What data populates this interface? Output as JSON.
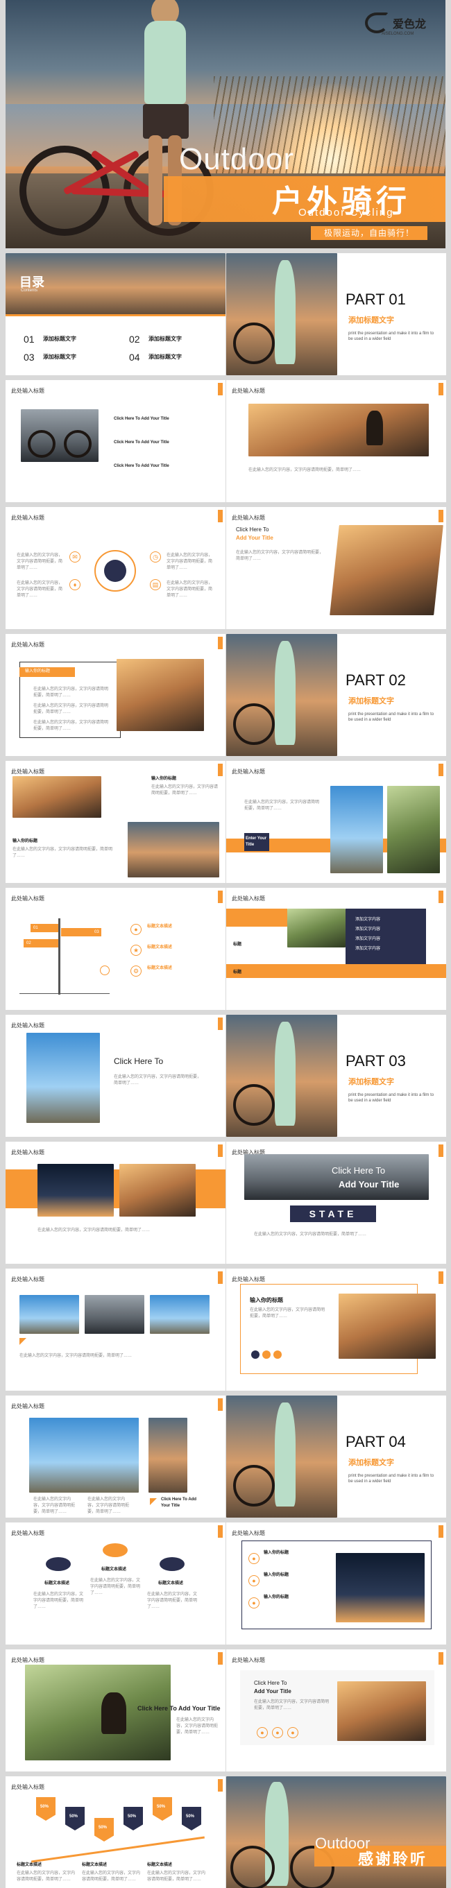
{
  "cover": {
    "title_en": "Outdoor",
    "title_cn": "户外骑行",
    "subtitle_en": "Outdoor Cycling",
    "tagline": "极限运动，自由骑行！",
    "logo_text": "爱色龙",
    "logo_sub": "AISELONG.COM"
  },
  "toc": {
    "title": "目录",
    "subtitle": "Contents",
    "items": [
      {
        "num": "01",
        "label": "添加标题文字"
      },
      {
        "num": "02",
        "label": "添加标题文字"
      },
      {
        "num": "03",
        "label": "添加标题文字"
      },
      {
        "num": "04",
        "label": "添加标题文字"
      }
    ]
  },
  "common": {
    "slide_heading": "此处输入标题",
    "add_title": "添加标题文字",
    "part_desc": "print the presentation and make it into a film to be used in a wider field",
    "click_here": "Click Here To",
    "add_your_title": "Add Your Title",
    "click_add": "Click Here To Add Your Title",
    "lorem": "在此输入您的文字内容，文字内容请简明扼要，简单明了……"
  },
  "parts": [
    "PART 01",
    "PART 02",
    "PART 03",
    "PART 04"
  ],
  "slides": {
    "s_input_title": "输入你的标题",
    "s_text_desc": "标题文本描述",
    "s_text": "添加文字内容",
    "enter_title": "Enter Your Title",
    "state": "STATE",
    "title_label": "标题",
    "flag_01": "01",
    "flag_02": "02",
    "flag_03": "03",
    "pct": [
      "50%",
      "50%",
      "50%",
      "50%",
      "50%",
      "50%"
    ]
  },
  "ending": {
    "title_en": "Outdoor",
    "title_cn": "感谢聆听"
  },
  "colors": {
    "accent": "#f79834",
    "navy": "#2a2f4e"
  }
}
